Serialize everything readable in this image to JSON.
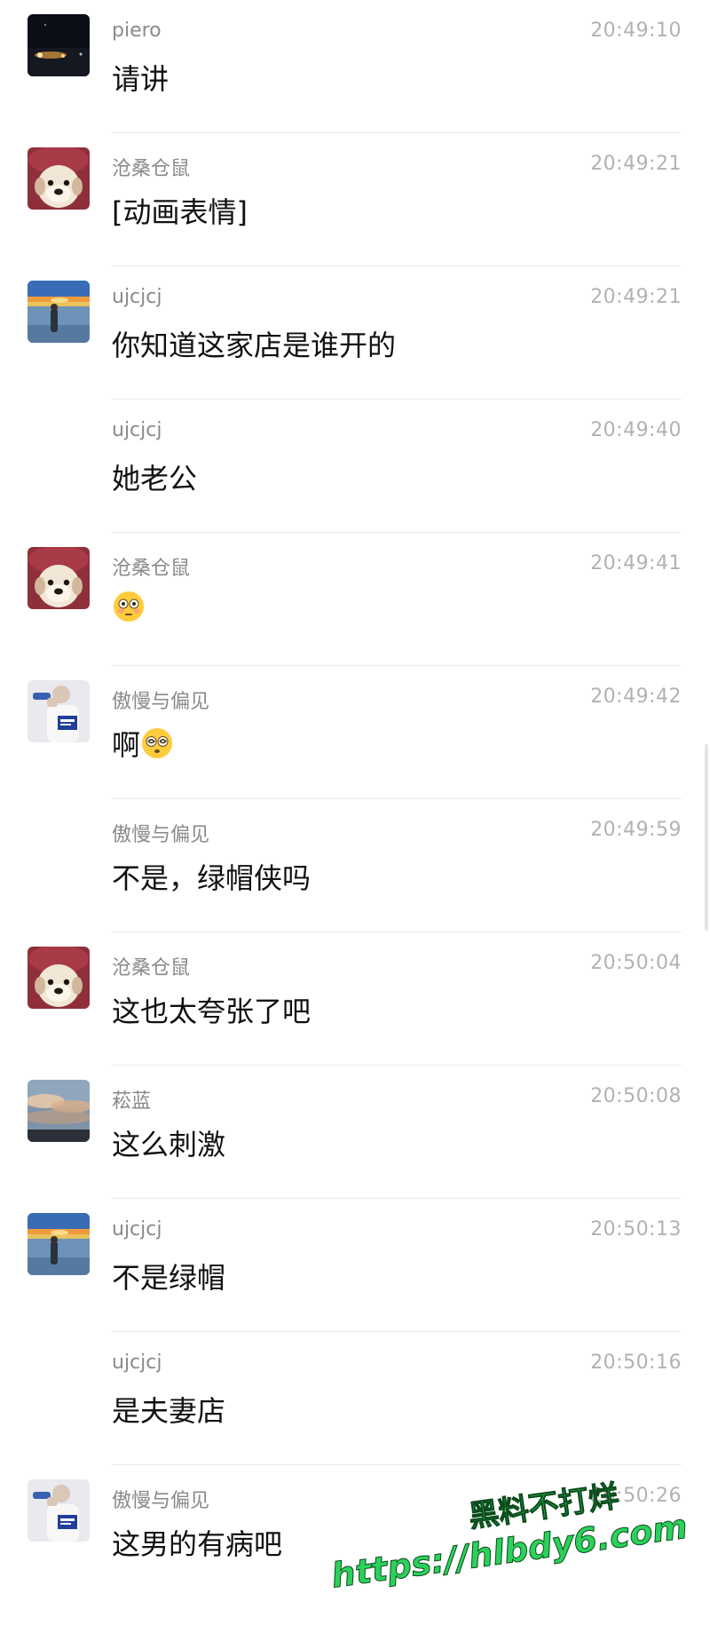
{
  "messages": [
    {
      "avatar": "dark-night-avatar",
      "sender": "piero",
      "time": "20:49:10",
      "text": "请讲",
      "emoji": ""
    },
    {
      "avatar": "dog-in-red-hat-avatar",
      "sender": "沧桑仓鼠",
      "time": "20:49:21",
      "text": "[动画表情]",
      "emoji": ""
    },
    {
      "avatar": "sunset-figure-avatar",
      "sender": "ujcjcj",
      "time": "20:49:21",
      "text": "你知道这家店是谁开的",
      "emoji": ""
    },
    {
      "avatar": "",
      "sender": "ujcjcj",
      "time": "20:49:40",
      "text": "她老公",
      "emoji": ""
    },
    {
      "avatar": "dog-in-red-hat-avatar",
      "sender": "沧桑仓鼠",
      "time": "20:49:41",
      "text": "",
      "emoji": "flushed-face-icon"
    },
    {
      "avatar": "person-drinking-avatar",
      "sender": "傲慢与偏见",
      "time": "20:49:42",
      "text": "啊",
      "emoji": "dizzy-face-icon"
    },
    {
      "avatar": "",
      "sender": "傲慢与偏见",
      "time": "20:49:59",
      "text": "不是，绿帽侠吗",
      "emoji": ""
    },
    {
      "avatar": "dog-in-red-hat-avatar",
      "sender": "沧桑仓鼠",
      "time": "20:50:04",
      "text": "这也太夸张了吧",
      "emoji": ""
    },
    {
      "avatar": "cloudy-sky-avatar",
      "sender": "菘蓝",
      "time": "20:50:08",
      "text": "这么刺激",
      "emoji": ""
    },
    {
      "avatar": "sunset-figure-avatar",
      "sender": "ujcjcj",
      "time": "20:50:13",
      "text": "不是绿帽",
      "emoji": ""
    },
    {
      "avatar": "",
      "sender": "ujcjcj",
      "time": "20:50:16",
      "text": "是夫妻店",
      "emoji": ""
    },
    {
      "avatar": "person-drinking-avatar",
      "sender": "傲慢与偏见",
      "time": "20:50:26",
      "text": "这男的有病吧",
      "emoji": ""
    }
  ],
  "watermark": {
    "line1": "黑料不打烊",
    "line2": "https://hlbdy6.com"
  },
  "colors": {
    "sender": "#8a8a8a",
    "time": "#b2b2b2",
    "text": "#111111",
    "divider": "#ececec",
    "watermark": "#2bd15a"
  }
}
